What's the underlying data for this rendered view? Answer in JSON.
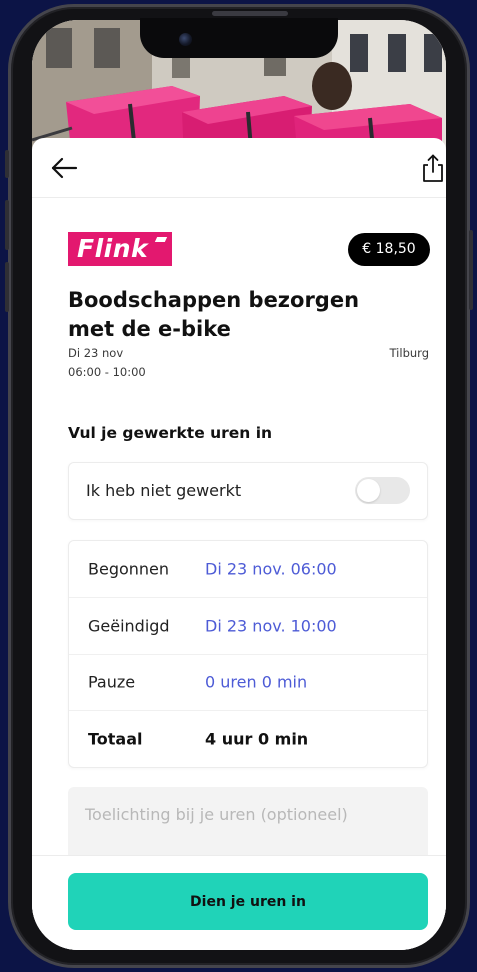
{
  "colors": {
    "background": "#0c1446",
    "brand": "#e3186f",
    "accent": "#20d3b8",
    "link": "#4d5bd6",
    "price_badge": "#000000"
  },
  "icons": {
    "back": "arrow-left-icon",
    "share": "share-icon"
  },
  "job": {
    "brand_logo_text": "Flink",
    "price": "€ 18,50",
    "title": "Boodschappen bezorgen met de e-bike",
    "date": "Di 23 nov",
    "time": "06:00 - 10:00",
    "location": "Tilburg"
  },
  "hours_form": {
    "heading": "Vul je gewerkte uren in",
    "not_worked": {
      "label": "Ik heb niet gewerkt",
      "checked": false
    },
    "rows": [
      {
        "label": "Begonnen",
        "value": "Di 23 nov. 06:00"
      },
      {
        "label": "Geëindigd",
        "value": "Di 23 nov. 10:00"
      },
      {
        "label": "Pauze",
        "value": "0 uren 0 min"
      },
      {
        "label": "Totaal",
        "value": "4 uur 0 min"
      }
    ],
    "comment": {
      "placeholder": "Toelichting bij je uren (optioneel)",
      "value": ""
    }
  },
  "submit": {
    "label": "Dien je uren in"
  }
}
